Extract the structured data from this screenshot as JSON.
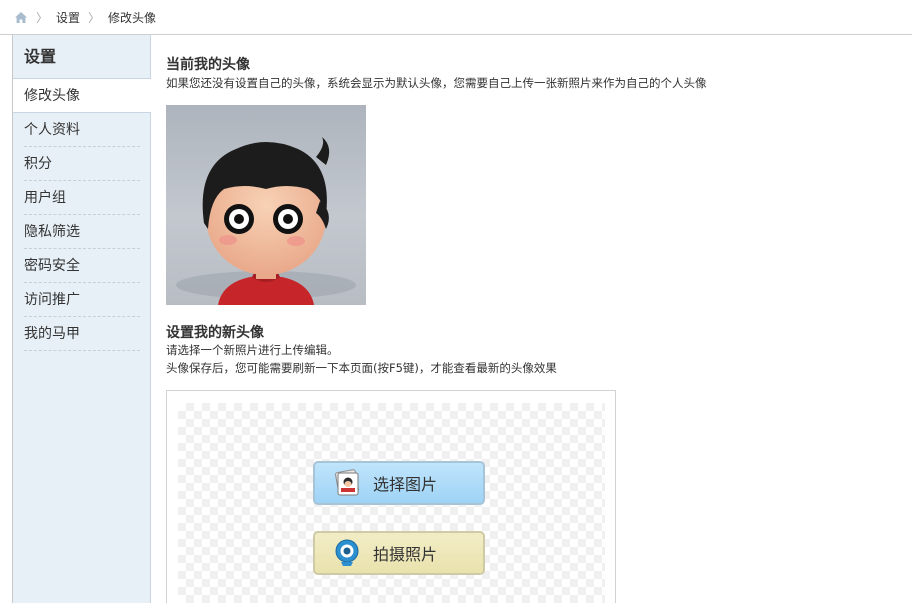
{
  "breadcrumb": {
    "home_icon": "home-icon",
    "items": [
      "设置",
      "修改头像"
    ]
  },
  "sidebar": {
    "title": "设置",
    "active_item": "修改头像",
    "items": [
      "个人资料",
      "积分",
      "用户组",
      "隐私筛选",
      "密码安全",
      "访问推广",
      "我的马甲"
    ]
  },
  "current_avatar": {
    "heading": "当前我的头像",
    "description": "如果您还没有设置自己的头像，系统会显示为默认头像，您需要自己上传一张新照片来作为自己的个人头像",
    "image": "default-avatar-cartoon-boy"
  },
  "new_avatar": {
    "heading": "设置我的新头像",
    "line1": "请选择一个新照片进行上传编辑。",
    "line2": "头像保存后，您可能需要刷新一下本页面(按F5键)，才能查看最新的头像效果",
    "select_button": "选择图片",
    "select_icon": "photo-icon",
    "camera_button": "拍摄照片",
    "camera_icon": "webcam-icon"
  },
  "colors": {
    "sidebar_bg": "#e8f0f7",
    "select_btn": "#a8d9f8",
    "camera_btn": "#ede7b6"
  }
}
